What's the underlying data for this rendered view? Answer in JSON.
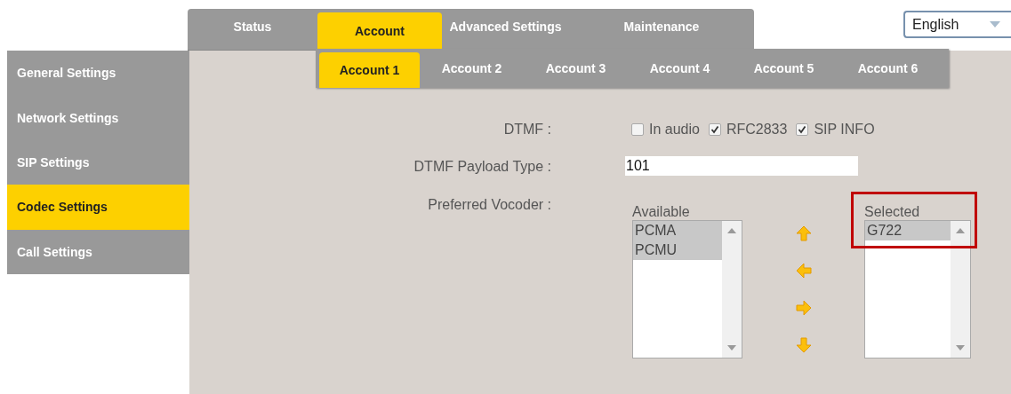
{
  "main_tabs": [
    {
      "label": "Status",
      "selected": false
    },
    {
      "label": "Account",
      "selected": true
    },
    {
      "label": "Advanced Settings",
      "selected": false
    },
    {
      "label": "Maintenance",
      "selected": false
    }
  ],
  "language": {
    "value": "English"
  },
  "sidebar": {
    "items": [
      {
        "label": "General Settings",
        "selected": false
      },
      {
        "label": "Network Settings",
        "selected": false
      },
      {
        "label": "SIP Settings",
        "selected": false
      },
      {
        "label": "Codec Settings",
        "selected": true
      },
      {
        "label": "Call Settings",
        "selected": false
      }
    ]
  },
  "account_tabs": [
    {
      "label": "Account 1",
      "selected": true
    },
    {
      "label": "Account 2",
      "selected": false
    },
    {
      "label": "Account 3",
      "selected": false
    },
    {
      "label": "Account 4",
      "selected": false
    },
    {
      "label": "Account 5",
      "selected": false
    },
    {
      "label": "Account 6",
      "selected": false
    }
  ],
  "dtmf": {
    "label": "DTMF :",
    "options": [
      {
        "label": "In audio",
        "checked": false
      },
      {
        "label": "RFC2833",
        "checked": true
      },
      {
        "label": "SIP INFO",
        "checked": true
      }
    ]
  },
  "payload_type": {
    "label": "DTMF Payload Type :",
    "value": "101"
  },
  "vocoder": {
    "label": "Preferred Vocoder :",
    "available": {
      "heading": "Available",
      "items": [
        {
          "label": "PCMA",
          "selected": true
        },
        {
          "label": "PCMU",
          "selected": true
        }
      ]
    },
    "selected_list": {
      "heading": "Selected",
      "highlighted": true,
      "items": [
        {
          "label": "G722",
          "selected": true
        }
      ]
    }
  }
}
